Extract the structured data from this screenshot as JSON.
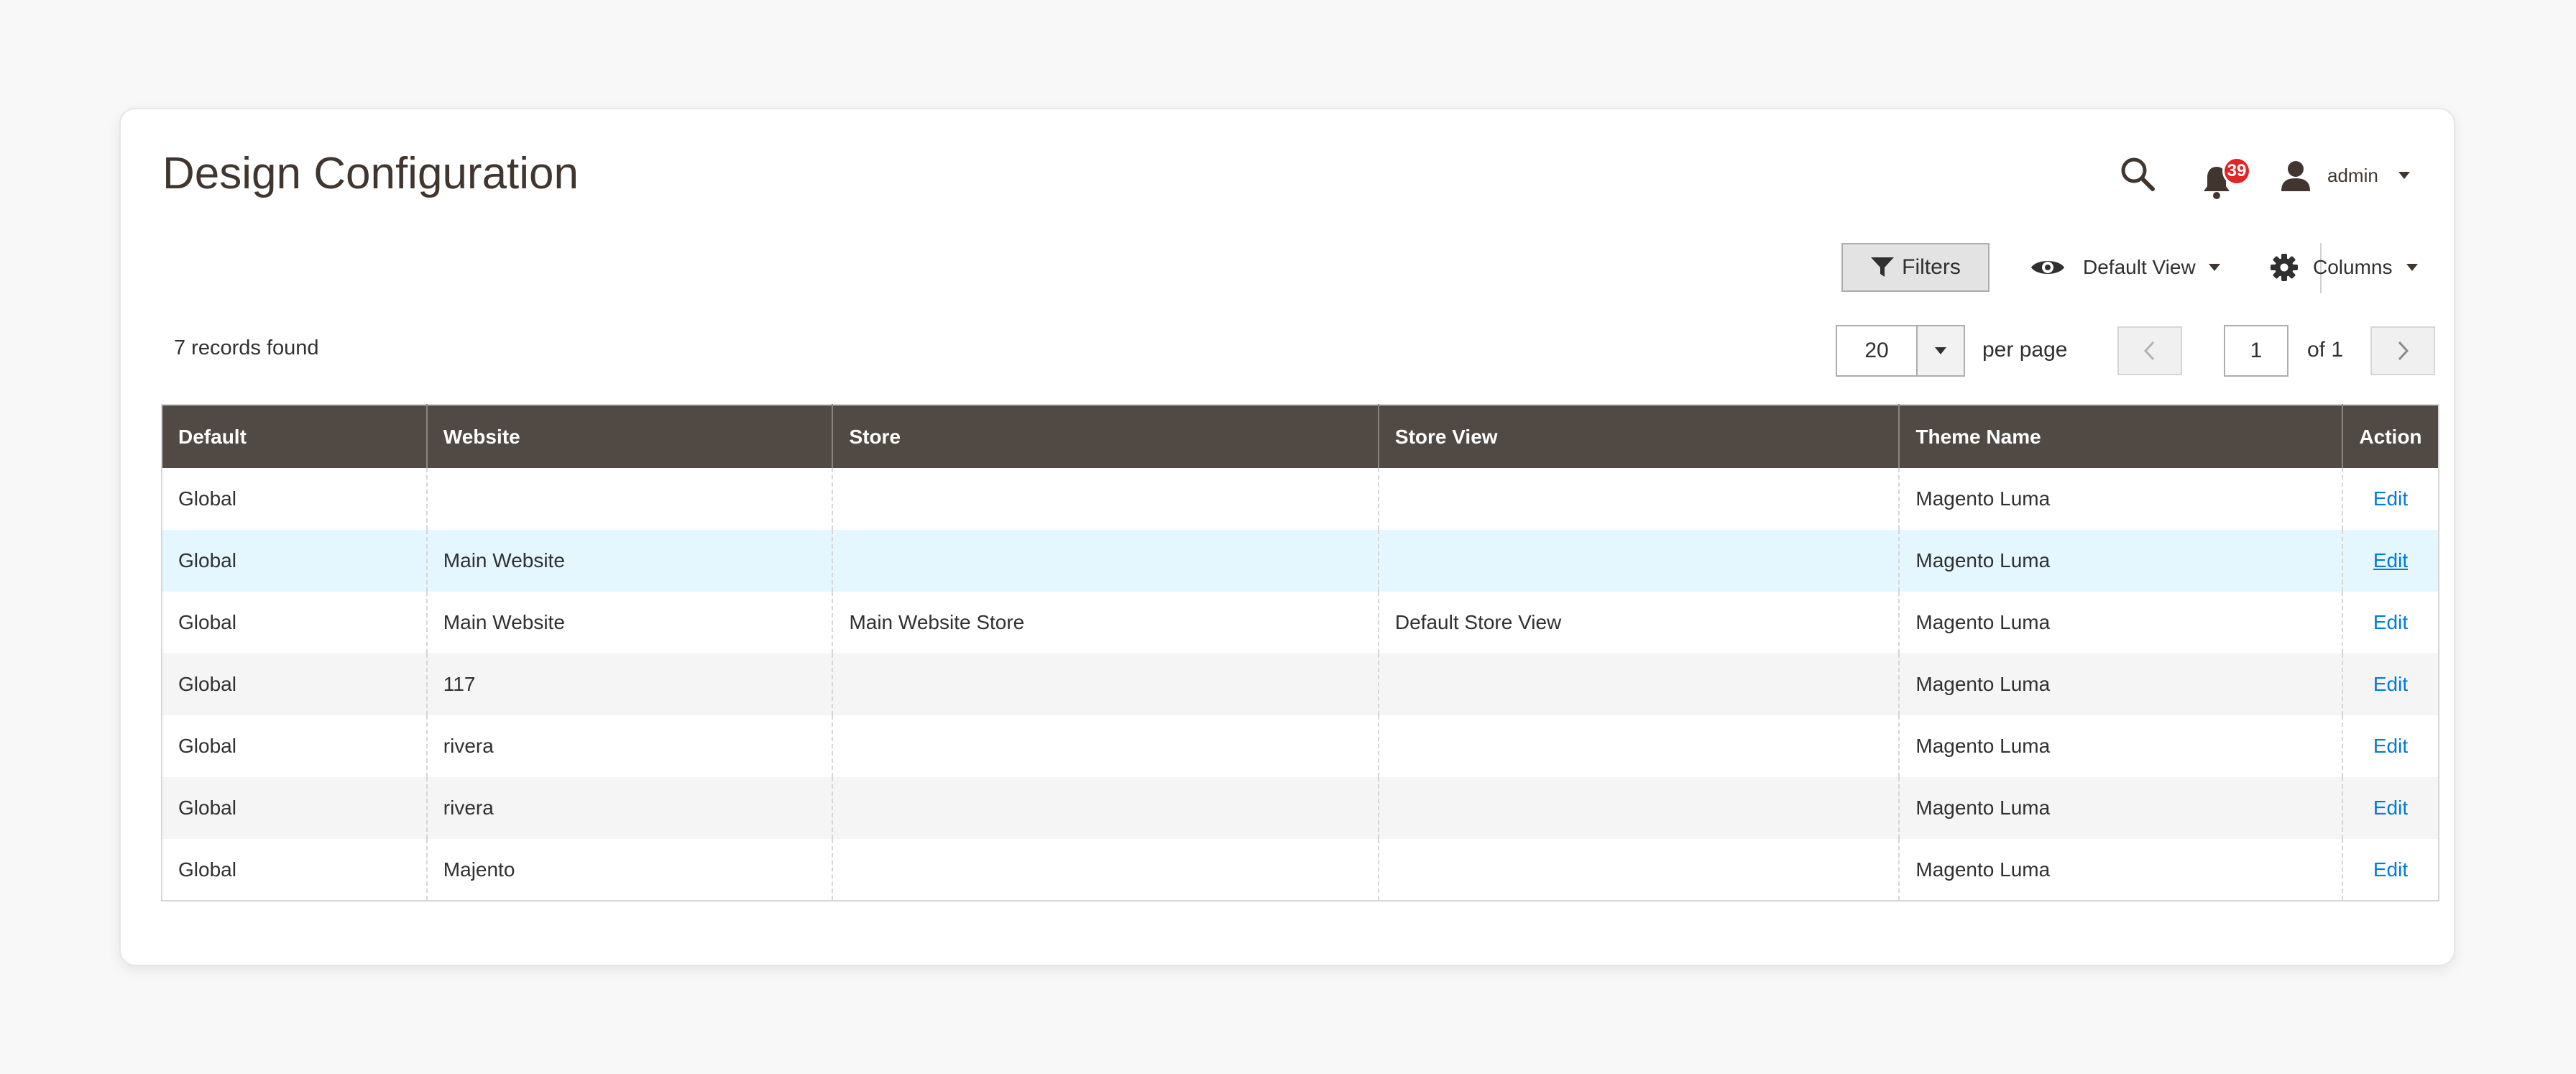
{
  "page": {
    "title": "Design Configuration"
  },
  "header": {
    "notifications_count": "39",
    "user_name": "admin"
  },
  "toolbar": {
    "filters_label": "Filters",
    "view_label": "Default View",
    "columns_label": "Columns"
  },
  "grid": {
    "records_text": "7 records found",
    "per_page_value": "20",
    "per_page_label": "per page",
    "current_page": "1",
    "page_of": "of 1",
    "columns": [
      "Default",
      "Website",
      "Store",
      "Store View",
      "Theme Name",
      "Action"
    ],
    "rows": [
      [
        "Global",
        "",
        "",
        "",
        "Magento Luma",
        "Edit"
      ],
      [
        "Global",
        "Main Website",
        "",
        "",
        "Magento Luma",
        "Edit"
      ],
      [
        "Global",
        "Main Website",
        "Main Website Store",
        "Default Store View",
        "Magento Luma",
        "Edit"
      ],
      [
        "Global",
        "117",
        "",
        "",
        "Magento Luma",
        "Edit"
      ],
      [
        "Global",
        "rivera",
        "",
        "",
        "Magento Luma",
        "Edit"
      ],
      [
        "Global",
        "rivera",
        "",
        "",
        "Magento Luma",
        "Edit"
      ],
      [
        "Global",
        "Majento",
        "",
        "",
        "Magento Luma",
        "Edit"
      ]
    ]
  },
  "colors": {
    "header_bg": "#514943",
    "link": "#007bdb",
    "badge": "#e22626",
    "row_hover": "#e5f7fe"
  },
  "icons": [
    "search-icon",
    "bell-icon",
    "user-icon",
    "funnel-icon",
    "eye-icon",
    "gear-icon",
    "chevron-left-icon",
    "chevron-right-icon"
  ]
}
